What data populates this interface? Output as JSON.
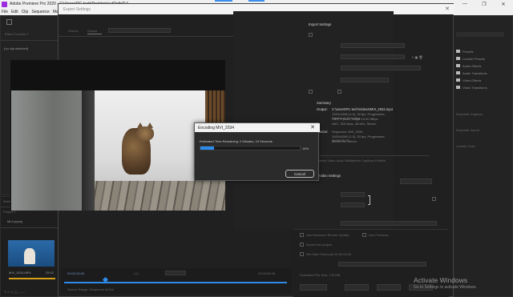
{
  "window": {
    "title": "Adobe Premiere Pro 2020 - C:\\Users\\PC-tech\\Desktop\\autRoltoR *",
    "controls": [
      "—",
      "❐",
      "✕"
    ]
  },
  "menu": [
    "File",
    "Edit",
    "Clip",
    "Sequence",
    "Mark"
  ],
  "left_panel": {
    "no_clip": "(no clip selected)",
    "bottom_label": "Mobile",
    "project_file": "Mt 6.prproj",
    "thumb_name": "MVI_2024.MP4",
    "thumb_duration": "29:42"
  },
  "export_dialog": {
    "title": "Export Settings",
    "tabs": [
      "Source",
      "Output"
    ],
    "timecode_left": "00:00:26:06",
    "timecode_right": "00:00:56:05",
    "settings_header": "Export Settings",
    "summary_label": "Summary",
    "output_label": "Output:",
    "output_lines": [
      "C:\\Users\\PC-tech\\Videos\\MVI_2034.mp4",
      "1920x1080 (1.0), 30 fps, Progressive, Hardware Encoding...",
      "VBR, 1 pass, Target 10.00 Mbps",
      "AAC, 320 kbps, 48 kHz, Stereo"
    ],
    "source_label": "Source:",
    "source_lines": [
      "Sequence, MVI_2034",
      "1920x1080 (1.0), 30 fps, Progressive, 00:02:28:04",
      "48000 Hz, Stereo"
    ],
    "video_settings": "Video Settings",
    "effects": [
      "Presets",
      "Lumetri Presets",
      "Audio Effects",
      "Audio Transitions",
      "Video Effects",
      "Video Transitions"
    ]
  },
  "encoding_dialog": {
    "title": "Encoding MVI_2034",
    "message": "Estimated Time Remaining: 2 Minutes, 15 Seconds",
    "progress": 0.14,
    "percent_label": "14%",
    "cancel_label": "Cancel"
  },
  "watermark": {
    "line1": "Activate Windows",
    "line2": "Go to Settings to activate Windows."
  }
}
